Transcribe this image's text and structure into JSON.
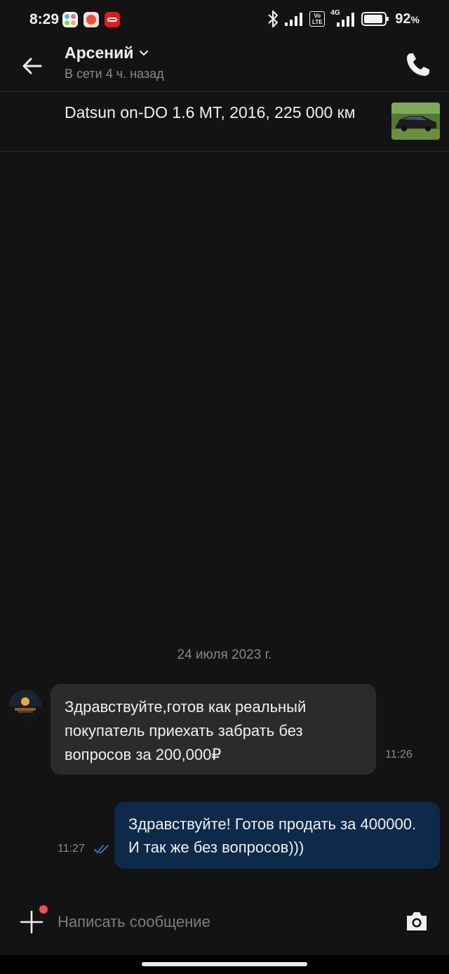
{
  "status_bar": {
    "time": "8:29",
    "battery_percent": "92",
    "battery_suffix": "%",
    "network": "4G",
    "volte": "Vo LTE",
    "icons": [
      "bluetooth-icon",
      "signal-icon",
      "volte-icon",
      "signal-4g-icon",
      "battery-icon"
    ]
  },
  "header": {
    "contact_name": "Арсений",
    "presence": "В сети 4 ч. назад",
    "icons": [
      "back-arrow-icon",
      "chevron-down-icon",
      "phone-icon"
    ]
  },
  "listing": {
    "title": "Datsun on-DO 1.6  MT, 2016, 225 000 км"
  },
  "chat": {
    "date_separator": "24 июля 2023 г.",
    "messages": [
      {
        "direction": "incoming",
        "text": "Здравствуйте,готов как реальный покупатель приехать забрать без вопросов за 200,000₽",
        "time": "11:26"
      },
      {
        "direction": "outgoing",
        "text": "Здравствуйте! Готов продать за 400000. И так же без вопросов)))",
        "time": "11:27",
        "status": "read"
      }
    ]
  },
  "composer": {
    "placeholder": "Написать сообщение",
    "value": "",
    "icons": [
      "plus-icon",
      "camera-icon"
    ]
  },
  "colors": {
    "background": "#131313",
    "incoming_bubble": "#2b2b2b",
    "outgoing_bubble": "#0e2a4a",
    "read_ticks": "#3d7fd0",
    "badge_dot": "#f0504f"
  }
}
